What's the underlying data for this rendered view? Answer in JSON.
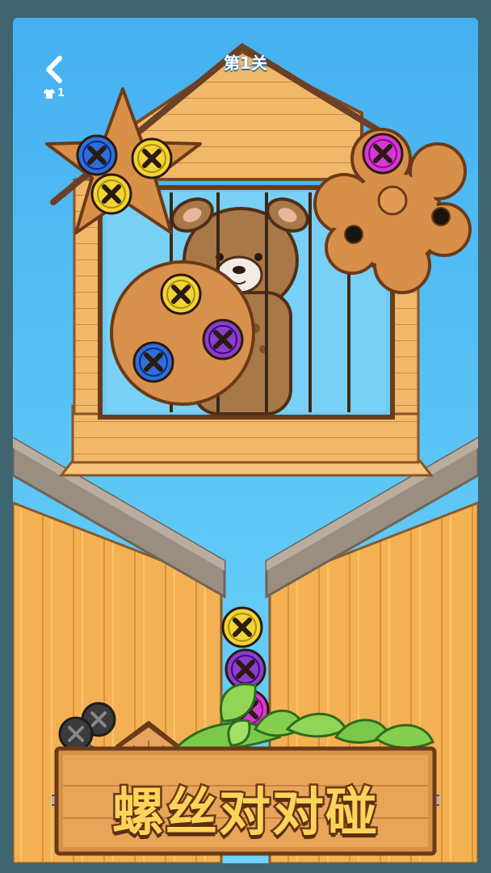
{
  "header": {
    "back_icon": "chevron-left-icon",
    "shirt_icon": "shirt-icon",
    "shirt_count": "1",
    "level_title": "第1关"
  },
  "game": {
    "title": "螺丝对对碰",
    "caged_character": "bear",
    "screw_colors": {
      "blue": "#2f6fd6",
      "yellow": "#f2d43a",
      "purple": "#8a3fc9",
      "magenta": "#d43bd0",
      "black": "#3a3a3a"
    },
    "star_plate_screws": [
      "blue",
      "yellow",
      "yellow"
    ],
    "flower_plate_screws": [
      "magenta"
    ],
    "round_plate_screws": [
      "yellow",
      "purple",
      "blue"
    ],
    "screw_stack": [
      "yellow",
      "purple",
      "magenta"
    ]
  },
  "colors": {
    "sky": "#4cbaf3",
    "wood": "#e8a858",
    "wood_dark": "#7a4a22",
    "frame": "#3f6571",
    "title_fill": "#ffd35a",
    "title_stroke": "#6a3a16"
  }
}
